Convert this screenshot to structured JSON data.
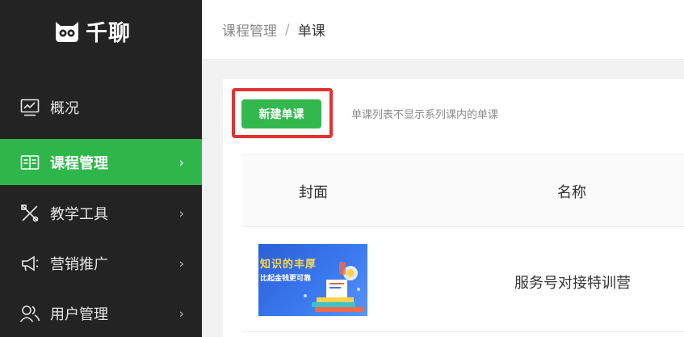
{
  "app": {
    "logo_text": "千聊",
    "colors": {
      "sidebar_bg": "#232323",
      "accent": "#2fb64b",
      "highlight": "#e23232"
    }
  },
  "sidebar": {
    "items": [
      {
        "label": "概况",
        "icon": "chart-monitor-icon",
        "active": false,
        "has_arrow": false
      },
      {
        "label": "课程管理",
        "icon": "book-icon",
        "active": true,
        "has_arrow": true
      },
      {
        "label": "教学工具",
        "icon": "tools-icon",
        "active": false,
        "has_arrow": true
      },
      {
        "label": "营销推广",
        "icon": "megaphone-icon",
        "active": false,
        "has_arrow": true
      },
      {
        "label": "用户管理",
        "icon": "users-icon",
        "active": false,
        "has_arrow": true
      }
    ],
    "arrow_glyph": "›"
  },
  "header": {
    "breadcrumb": {
      "parent": "课程管理",
      "separator": "/",
      "current": "单课"
    }
  },
  "main": {
    "new_button_label": "新建单课",
    "hint": "单课列表不显示系列课内的单课",
    "table": {
      "columns": [
        "封面",
        "名称"
      ],
      "rows": [
        {
          "cover": {
            "title": "知识的丰厚",
            "subtitle": "比起金钱更可靠"
          },
          "name": "服务号对接特训营"
        }
      ]
    }
  }
}
